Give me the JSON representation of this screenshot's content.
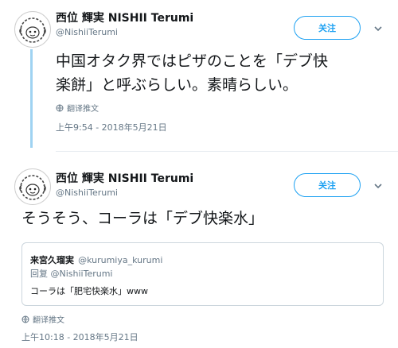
{
  "tweet1": {
    "display_name": "西位 輝実 NISHII Terumi",
    "handle": "@NishiiTerumi",
    "follow_label": "关注",
    "text_line1": "中国オタク界ではピザのことを「デブ快",
    "text_line2": "楽餅」と呼ぶらしい。素晴らしい。",
    "translate_label": "翻译推文",
    "timestamp": "上午9:54 - 2018年5月21日"
  },
  "tweet2": {
    "display_name": "西位 輝実 NISHII Terumi",
    "handle": "@NishiiTerumi",
    "follow_label": "关注",
    "text": "そうそう、コーラは「デブ快楽水」",
    "quote": {
      "display_name": "来宮久瑠実",
      "handle": "@kurumiya_kurumi",
      "reply_to": "回复 @NishiiTerumi",
      "text": "コーラは「肥宅快楽水」www"
    },
    "translate_label": "翻译推文",
    "timestamp": "上午10:18 - 2018年5月21日"
  },
  "icons": {
    "avatar": "sheep-avatar",
    "dropdown": "chevron-down-icon",
    "translate": "globe-icon"
  },
  "colors": {
    "accent": "#1da1f2",
    "thread_line": "#9fd3f2",
    "muted_text": "#657786"
  }
}
